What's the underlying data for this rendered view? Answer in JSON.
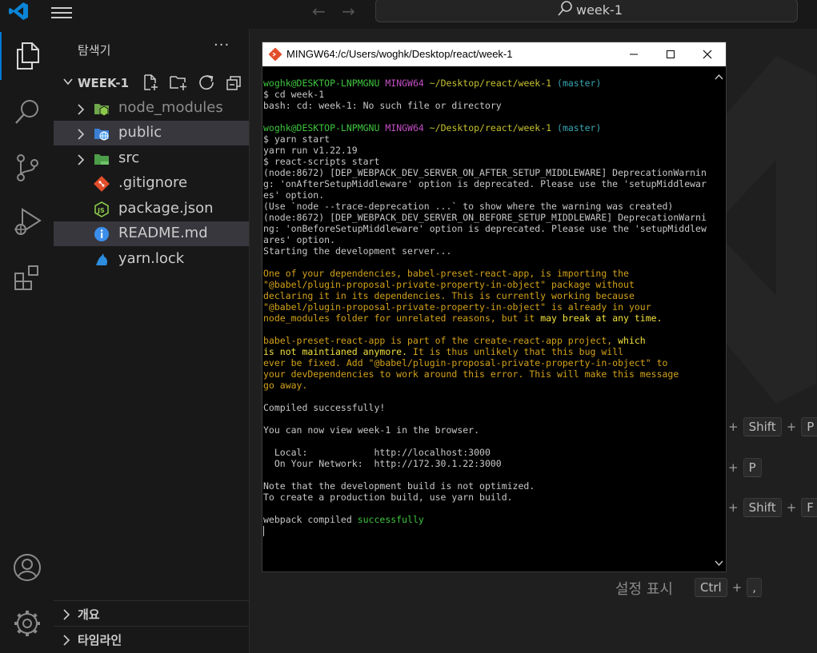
{
  "titlebar": {
    "search_text": "week-1"
  },
  "sidebar": {
    "title": "탐색기",
    "more": "···",
    "folder": "WEEK-1",
    "items": [
      {
        "label": "node_modules",
        "icon": "node-folder-icon"
      },
      {
        "label": "public",
        "icon": "globe-folder-icon"
      },
      {
        "label": "src",
        "icon": "folder-icon"
      },
      {
        "label": ".gitignore",
        "icon": "git-icon"
      },
      {
        "label": "package.json",
        "icon": "nodejs-icon"
      },
      {
        "label": "README.md",
        "icon": "info-icon"
      },
      {
        "label": "yarn.lock",
        "icon": "yarn-icon"
      }
    ],
    "sections": [
      "개요",
      "타임라인"
    ]
  },
  "terminal": {
    "title": "MINGW64:/c/Users/woghk/Desktop/react/week-1",
    "user": "woghk@DESKTOP-LNPMGNU",
    "shell": "MINGW64",
    "path": "~/Desktop/react/week-1",
    "branch": "(master)",
    "lines": {
      "l1": "$ cd week-1",
      "l2": "bash: cd: week-1: No such file or directory",
      "l3": "$ yarn start",
      "l4": "yarn run v1.22.19",
      "l5": "$ react-scripts start",
      "l6": "(node:8672) [DEP_WEBPACK_DEV_SERVER_ON_AFTER_SETUP_MIDDLEWARE] DeprecationWarnin",
      "l7": "g: 'onAfterSetupMiddleware' option is deprecated. Please use the 'setupMiddlewar",
      "l8": "es' option.",
      "l9": "(Use `node --trace-deprecation ...` to show where the warning was created)",
      "l10": "(node:8672) [DEP_WEBPACK_DEV_SERVER_ON_BEFORE_SETUP_MIDDLEWARE] DeprecationWarni",
      "l11": "ng: 'onBeforeSetupMiddleware' option is deprecated. Please use the 'setupMiddlew",
      "l12": "ares' option.",
      "l13": "Starting the development server...",
      "b1": "One of your dependencies, babel-preset-react-app, is importing the",
      "b2": "\"@babel/plugin-proposal-private-property-in-object\" package without",
      "b3": "declaring it in its dependencies. This is currently working because",
      "b4": "\"@babel/plugin-proposal-private-property-in-object\" is already in your",
      "b5a": "node_modules folder for unrelated reasons, but it ",
      "b5b": "may break at any time.",
      "c1a": "babel-preset-react-app is part of the create-react-app project, ",
      "c1b": "which",
      "c2a": "is not maintianed anymore.",
      "c2b": " It is thus unlikely that this bug will",
      "c3": "ever be fixed. Add \"@babel/plugin-proposal-private-property-in-object\" to",
      "c4": "your devDependencies to work around this error. This will make this message",
      "c5": "go away.",
      "d1": "Compiled successfully!",
      "d2": "You can now view week-1 in the browser.",
      "d3": "  Local:            http://localhost:3000",
      "d4": "  On Your Network:  http://172.30.1.22:3000",
      "d5": "Note that the development build is not optimized.",
      "d6": "To create a production build, use yarn build.",
      "d7a": "webpack compiled ",
      "d7b": "successfully"
    }
  },
  "shortcuts": {
    "row1": [
      "+",
      "Shift",
      "+",
      "P"
    ],
    "row2": [
      "+",
      "P"
    ],
    "row3": [
      "+",
      "Shift",
      "+",
      "F"
    ],
    "settings_label": "설정 표시",
    "settings_keys": [
      "Ctrl",
      "+",
      ","
    ]
  }
}
